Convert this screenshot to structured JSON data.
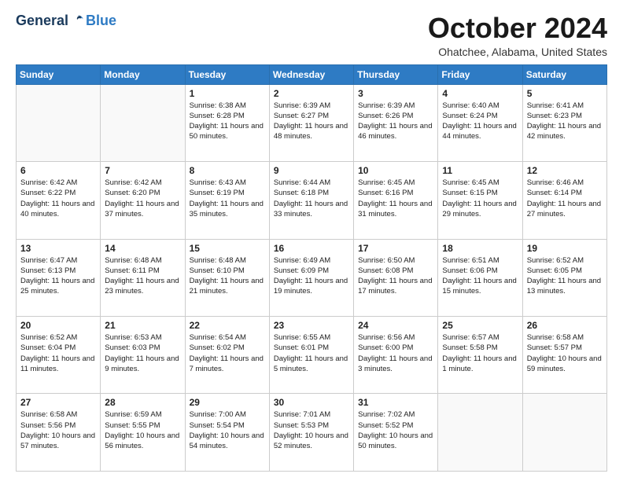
{
  "header": {
    "logo_general": "General",
    "logo_blue": "Blue",
    "month_title": "October 2024",
    "location": "Ohatchee, Alabama, United States"
  },
  "days_of_week": [
    "Sunday",
    "Monday",
    "Tuesday",
    "Wednesday",
    "Thursday",
    "Friday",
    "Saturday"
  ],
  "weeks": [
    [
      {
        "day": "",
        "empty": true
      },
      {
        "day": "",
        "empty": true
      },
      {
        "day": "1",
        "sunrise": "Sunrise: 6:38 AM",
        "sunset": "Sunset: 6:28 PM",
        "daylight": "Daylight: 11 hours and 50 minutes."
      },
      {
        "day": "2",
        "sunrise": "Sunrise: 6:39 AM",
        "sunset": "Sunset: 6:27 PM",
        "daylight": "Daylight: 11 hours and 48 minutes."
      },
      {
        "day": "3",
        "sunrise": "Sunrise: 6:39 AM",
        "sunset": "Sunset: 6:26 PM",
        "daylight": "Daylight: 11 hours and 46 minutes."
      },
      {
        "day": "4",
        "sunrise": "Sunrise: 6:40 AM",
        "sunset": "Sunset: 6:24 PM",
        "daylight": "Daylight: 11 hours and 44 minutes."
      },
      {
        "day": "5",
        "sunrise": "Sunrise: 6:41 AM",
        "sunset": "Sunset: 6:23 PM",
        "daylight": "Daylight: 11 hours and 42 minutes."
      }
    ],
    [
      {
        "day": "6",
        "sunrise": "Sunrise: 6:42 AM",
        "sunset": "Sunset: 6:22 PM",
        "daylight": "Daylight: 11 hours and 40 minutes."
      },
      {
        "day": "7",
        "sunrise": "Sunrise: 6:42 AM",
        "sunset": "Sunset: 6:20 PM",
        "daylight": "Daylight: 11 hours and 37 minutes."
      },
      {
        "day": "8",
        "sunrise": "Sunrise: 6:43 AM",
        "sunset": "Sunset: 6:19 PM",
        "daylight": "Daylight: 11 hours and 35 minutes."
      },
      {
        "day": "9",
        "sunrise": "Sunrise: 6:44 AM",
        "sunset": "Sunset: 6:18 PM",
        "daylight": "Daylight: 11 hours and 33 minutes."
      },
      {
        "day": "10",
        "sunrise": "Sunrise: 6:45 AM",
        "sunset": "Sunset: 6:16 PM",
        "daylight": "Daylight: 11 hours and 31 minutes."
      },
      {
        "day": "11",
        "sunrise": "Sunrise: 6:45 AM",
        "sunset": "Sunset: 6:15 PM",
        "daylight": "Daylight: 11 hours and 29 minutes."
      },
      {
        "day": "12",
        "sunrise": "Sunrise: 6:46 AM",
        "sunset": "Sunset: 6:14 PM",
        "daylight": "Daylight: 11 hours and 27 minutes."
      }
    ],
    [
      {
        "day": "13",
        "sunrise": "Sunrise: 6:47 AM",
        "sunset": "Sunset: 6:13 PM",
        "daylight": "Daylight: 11 hours and 25 minutes."
      },
      {
        "day": "14",
        "sunrise": "Sunrise: 6:48 AM",
        "sunset": "Sunset: 6:11 PM",
        "daylight": "Daylight: 11 hours and 23 minutes."
      },
      {
        "day": "15",
        "sunrise": "Sunrise: 6:48 AM",
        "sunset": "Sunset: 6:10 PM",
        "daylight": "Daylight: 11 hours and 21 minutes."
      },
      {
        "day": "16",
        "sunrise": "Sunrise: 6:49 AM",
        "sunset": "Sunset: 6:09 PM",
        "daylight": "Daylight: 11 hours and 19 minutes."
      },
      {
        "day": "17",
        "sunrise": "Sunrise: 6:50 AM",
        "sunset": "Sunset: 6:08 PM",
        "daylight": "Daylight: 11 hours and 17 minutes."
      },
      {
        "day": "18",
        "sunrise": "Sunrise: 6:51 AM",
        "sunset": "Sunset: 6:06 PM",
        "daylight": "Daylight: 11 hours and 15 minutes."
      },
      {
        "day": "19",
        "sunrise": "Sunrise: 6:52 AM",
        "sunset": "Sunset: 6:05 PM",
        "daylight": "Daylight: 11 hours and 13 minutes."
      }
    ],
    [
      {
        "day": "20",
        "sunrise": "Sunrise: 6:52 AM",
        "sunset": "Sunset: 6:04 PM",
        "daylight": "Daylight: 11 hours and 11 minutes."
      },
      {
        "day": "21",
        "sunrise": "Sunrise: 6:53 AM",
        "sunset": "Sunset: 6:03 PM",
        "daylight": "Daylight: 11 hours and 9 minutes."
      },
      {
        "day": "22",
        "sunrise": "Sunrise: 6:54 AM",
        "sunset": "Sunset: 6:02 PM",
        "daylight": "Daylight: 11 hours and 7 minutes."
      },
      {
        "day": "23",
        "sunrise": "Sunrise: 6:55 AM",
        "sunset": "Sunset: 6:01 PM",
        "daylight": "Daylight: 11 hours and 5 minutes."
      },
      {
        "day": "24",
        "sunrise": "Sunrise: 6:56 AM",
        "sunset": "Sunset: 6:00 PM",
        "daylight": "Daylight: 11 hours and 3 minutes."
      },
      {
        "day": "25",
        "sunrise": "Sunrise: 6:57 AM",
        "sunset": "Sunset: 5:58 PM",
        "daylight": "Daylight: 11 hours and 1 minute."
      },
      {
        "day": "26",
        "sunrise": "Sunrise: 6:58 AM",
        "sunset": "Sunset: 5:57 PM",
        "daylight": "Daylight: 10 hours and 59 minutes."
      }
    ],
    [
      {
        "day": "27",
        "sunrise": "Sunrise: 6:58 AM",
        "sunset": "Sunset: 5:56 PM",
        "daylight": "Daylight: 10 hours and 57 minutes."
      },
      {
        "day": "28",
        "sunrise": "Sunrise: 6:59 AM",
        "sunset": "Sunset: 5:55 PM",
        "daylight": "Daylight: 10 hours and 56 minutes."
      },
      {
        "day": "29",
        "sunrise": "Sunrise: 7:00 AM",
        "sunset": "Sunset: 5:54 PM",
        "daylight": "Daylight: 10 hours and 54 minutes."
      },
      {
        "day": "30",
        "sunrise": "Sunrise: 7:01 AM",
        "sunset": "Sunset: 5:53 PM",
        "daylight": "Daylight: 10 hours and 52 minutes."
      },
      {
        "day": "31",
        "sunrise": "Sunrise: 7:02 AM",
        "sunset": "Sunset: 5:52 PM",
        "daylight": "Daylight: 10 hours and 50 minutes."
      },
      {
        "day": "",
        "empty": true
      },
      {
        "day": "",
        "empty": true
      }
    ]
  ]
}
